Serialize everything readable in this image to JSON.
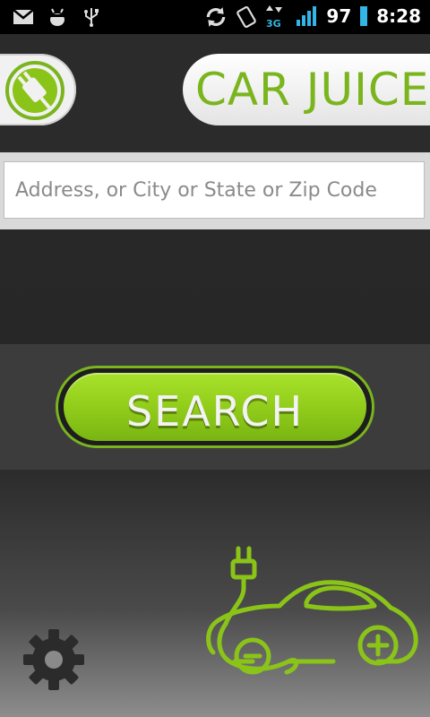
{
  "status_bar": {
    "battery_level": "97",
    "time": "8:28",
    "icons": [
      "gmail-icon",
      "android-debug-icon",
      "usb-icon",
      "sync-icon",
      "screen-rotate-icon",
      "3g-data-icon",
      "signal-icon",
      "battery-icon"
    ]
  },
  "header": {
    "brand": "CAR JUICE",
    "logo_icon": "plug-icon"
  },
  "search": {
    "placeholder": "Address, or City or State or Zip Code",
    "value": ""
  },
  "actions": {
    "search_label": "SEARCH",
    "settings_icon": "gear-icon"
  },
  "colors": {
    "accent": "#7ab51d",
    "button_green": "#94cf1c",
    "statusbar_blue": "#33b5e5"
  }
}
